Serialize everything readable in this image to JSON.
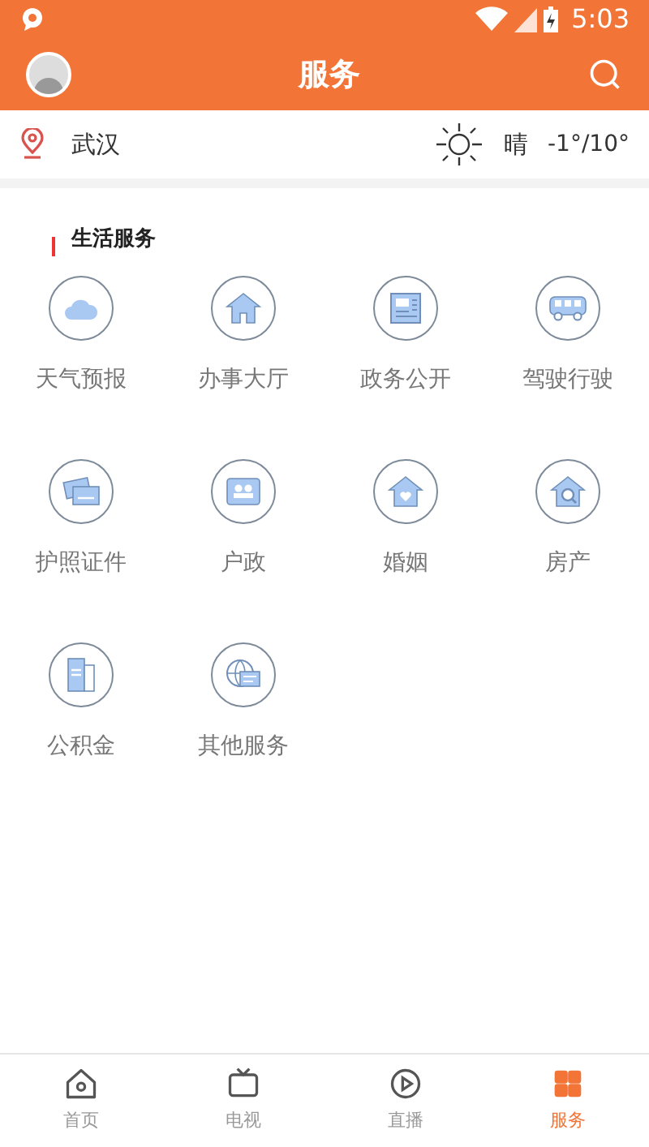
{
  "status_bar": {
    "time": "5:03"
  },
  "header": {
    "title": "服务"
  },
  "location_bar": {
    "city": "武汉",
    "weather": "晴",
    "temperature": "-1°/10°"
  },
  "section": {
    "title": "生活服务"
  },
  "services": [
    {
      "label": "天气预报"
    },
    {
      "label": "办事大厅"
    },
    {
      "label": "政务公开"
    },
    {
      "label": "驾驶行驶"
    },
    {
      "label": "护照证件"
    },
    {
      "label": "户政"
    },
    {
      "label": "婚姻"
    },
    {
      "label": "房产"
    },
    {
      "label": "公积金"
    },
    {
      "label": "其他服务"
    }
  ],
  "tab_bar": [
    {
      "label": "首页",
      "selected": false
    },
    {
      "label": "电视",
      "selected": false
    },
    {
      "label": "直播",
      "selected": false
    },
    {
      "label": "服务",
      "selected": true
    }
  ]
}
